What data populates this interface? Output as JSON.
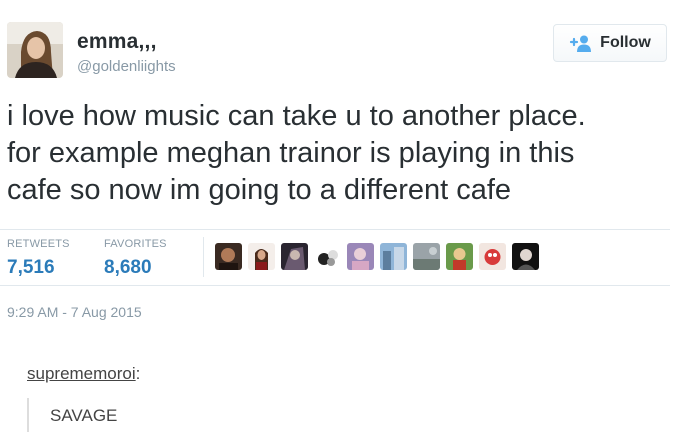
{
  "user": {
    "name": "emma,,,",
    "handle": "@goldenliights"
  },
  "follow_button": {
    "label": "Follow",
    "icon": "add-user-icon",
    "color": "#55acee"
  },
  "tweet": {
    "lines": [
      "i love how music can take u to another place.",
      "for example meghan trainor is playing in this",
      "cafe so now im going to a different cafe"
    ]
  },
  "stats": {
    "retweets_label": "RETWEETS",
    "retweets_value": "7,516",
    "favorites_label": "FAVORITES",
    "favorites_value": "8,680"
  },
  "favorited_by_count_shown": 10,
  "timestamp": "9:29 AM - 7 Aug 2015",
  "reblog": {
    "username": "suprememoroi",
    "separator": ":",
    "quote": "SAVAGE"
  },
  "colors": {
    "link_blue": "#2b7bb9",
    "muted_gray": "#8899a6",
    "text": "#292f33"
  }
}
